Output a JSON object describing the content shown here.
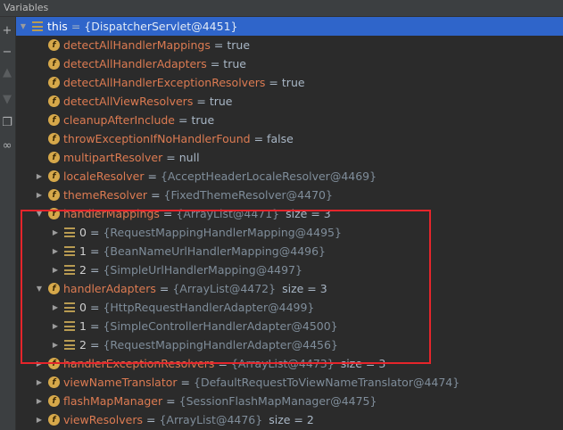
{
  "panel": {
    "title": "Variables"
  },
  "toolbar": {
    "icons": [
      "plus-icon",
      "minus-icon",
      "arrow-up-icon",
      "arrow-down-icon",
      "copy-icon",
      "glasses-icon"
    ]
  },
  "rows": [
    {
      "name": "this",
      "eq": "=",
      "value": "{DispatcherServlet@4451}",
      "size": "",
      "icon": "list",
      "arrow": "open",
      "indent": 0,
      "selected": true
    },
    {
      "name": "detectAllHandlerMappings",
      "eq": "=",
      "value": "true",
      "size": "",
      "icon": "f",
      "arrow": "none",
      "indent": 1
    },
    {
      "name": "detectAllHandlerAdapters",
      "eq": "=",
      "value": "true",
      "size": "",
      "icon": "f",
      "arrow": "none",
      "indent": 1
    },
    {
      "name": "detectAllHandlerExceptionResolvers",
      "eq": "=",
      "value": "true",
      "size": "",
      "icon": "f",
      "arrow": "none",
      "indent": 1
    },
    {
      "name": "detectAllViewResolvers",
      "eq": "=",
      "value": "true",
      "size": "",
      "icon": "f",
      "arrow": "none",
      "indent": 1
    },
    {
      "name": "cleanupAfterInclude",
      "eq": "=",
      "value": "true",
      "size": "",
      "icon": "f",
      "arrow": "none",
      "indent": 1
    },
    {
      "name": "throwExceptionIfNoHandlerFound",
      "eq": "=",
      "value": "false",
      "size": "",
      "icon": "f",
      "arrow": "none",
      "indent": 1
    },
    {
      "name": "multipartResolver",
      "eq": "=",
      "value": "null",
      "size": "",
      "icon": "f",
      "arrow": "none",
      "indent": 1
    },
    {
      "name": "localeResolver",
      "eq": "=",
      "value": "{AcceptHeaderLocaleResolver@4469}",
      "size": "",
      "icon": "f",
      "arrow": "closed",
      "indent": 1
    },
    {
      "name": "themeResolver",
      "eq": "=",
      "value": "{FixedThemeResolver@4470}",
      "size": "",
      "icon": "f",
      "arrow": "closed",
      "indent": 1
    },
    {
      "name": "handlerMappings",
      "eq": "=",
      "value": "{ArrayList@4471}",
      "size": "size = 3",
      "icon": "f",
      "arrow": "open",
      "indent": 1
    },
    {
      "name": "0",
      "eq": "=",
      "value": "{RequestMappingHandlerMapping@4495}",
      "size": "",
      "icon": "list",
      "arrow": "closed",
      "indent": 2
    },
    {
      "name": "1",
      "eq": "=",
      "value": "{BeanNameUrlHandlerMapping@4496}",
      "size": "",
      "icon": "list",
      "arrow": "closed",
      "indent": 2
    },
    {
      "name": "2",
      "eq": "=",
      "value": "{SimpleUrlHandlerMapping@4497}",
      "size": "",
      "icon": "list",
      "arrow": "closed",
      "indent": 2
    },
    {
      "name": "handlerAdapters",
      "eq": "=",
      "value": "{ArrayList@4472}",
      "size": "size = 3",
      "icon": "f",
      "arrow": "open",
      "indent": 1
    },
    {
      "name": "0",
      "eq": "=",
      "value": "{HttpRequestHandlerAdapter@4499}",
      "size": "",
      "icon": "list",
      "arrow": "closed",
      "indent": 2
    },
    {
      "name": "1",
      "eq": "=",
      "value": "{SimpleControllerHandlerAdapter@4500}",
      "size": "",
      "icon": "list",
      "arrow": "closed",
      "indent": 2
    },
    {
      "name": "2",
      "eq": "=",
      "value": "{RequestMappingHandlerAdapter@4456}",
      "size": "",
      "icon": "list",
      "arrow": "closed",
      "indent": 2
    },
    {
      "name": "handlerExceptionResolvers",
      "eq": "=",
      "value": "{ArrayList@4473}",
      "size": "size = 3",
      "icon": "f",
      "arrow": "closed",
      "indent": 1
    },
    {
      "name": "viewNameTranslator",
      "eq": "=",
      "value": "{DefaultRequestToViewNameTranslator@4474}",
      "size": "",
      "icon": "f",
      "arrow": "closed",
      "indent": 1
    },
    {
      "name": "flashMapManager",
      "eq": "=",
      "value": "{SessionFlashMapManager@4475}",
      "size": "",
      "icon": "f",
      "arrow": "closed",
      "indent": 1
    },
    {
      "name": "viewResolvers",
      "eq": "=",
      "value": "{ArrayList@4476}",
      "size": "size = 2",
      "icon": "f",
      "arrow": "closed",
      "indent": 1
    }
  ],
  "icon_labels": {
    "field": "f"
  },
  "colors": {
    "selection": "#2f65ca",
    "highlight_box": "#e5252b",
    "field_name": "#dc7b52"
  }
}
